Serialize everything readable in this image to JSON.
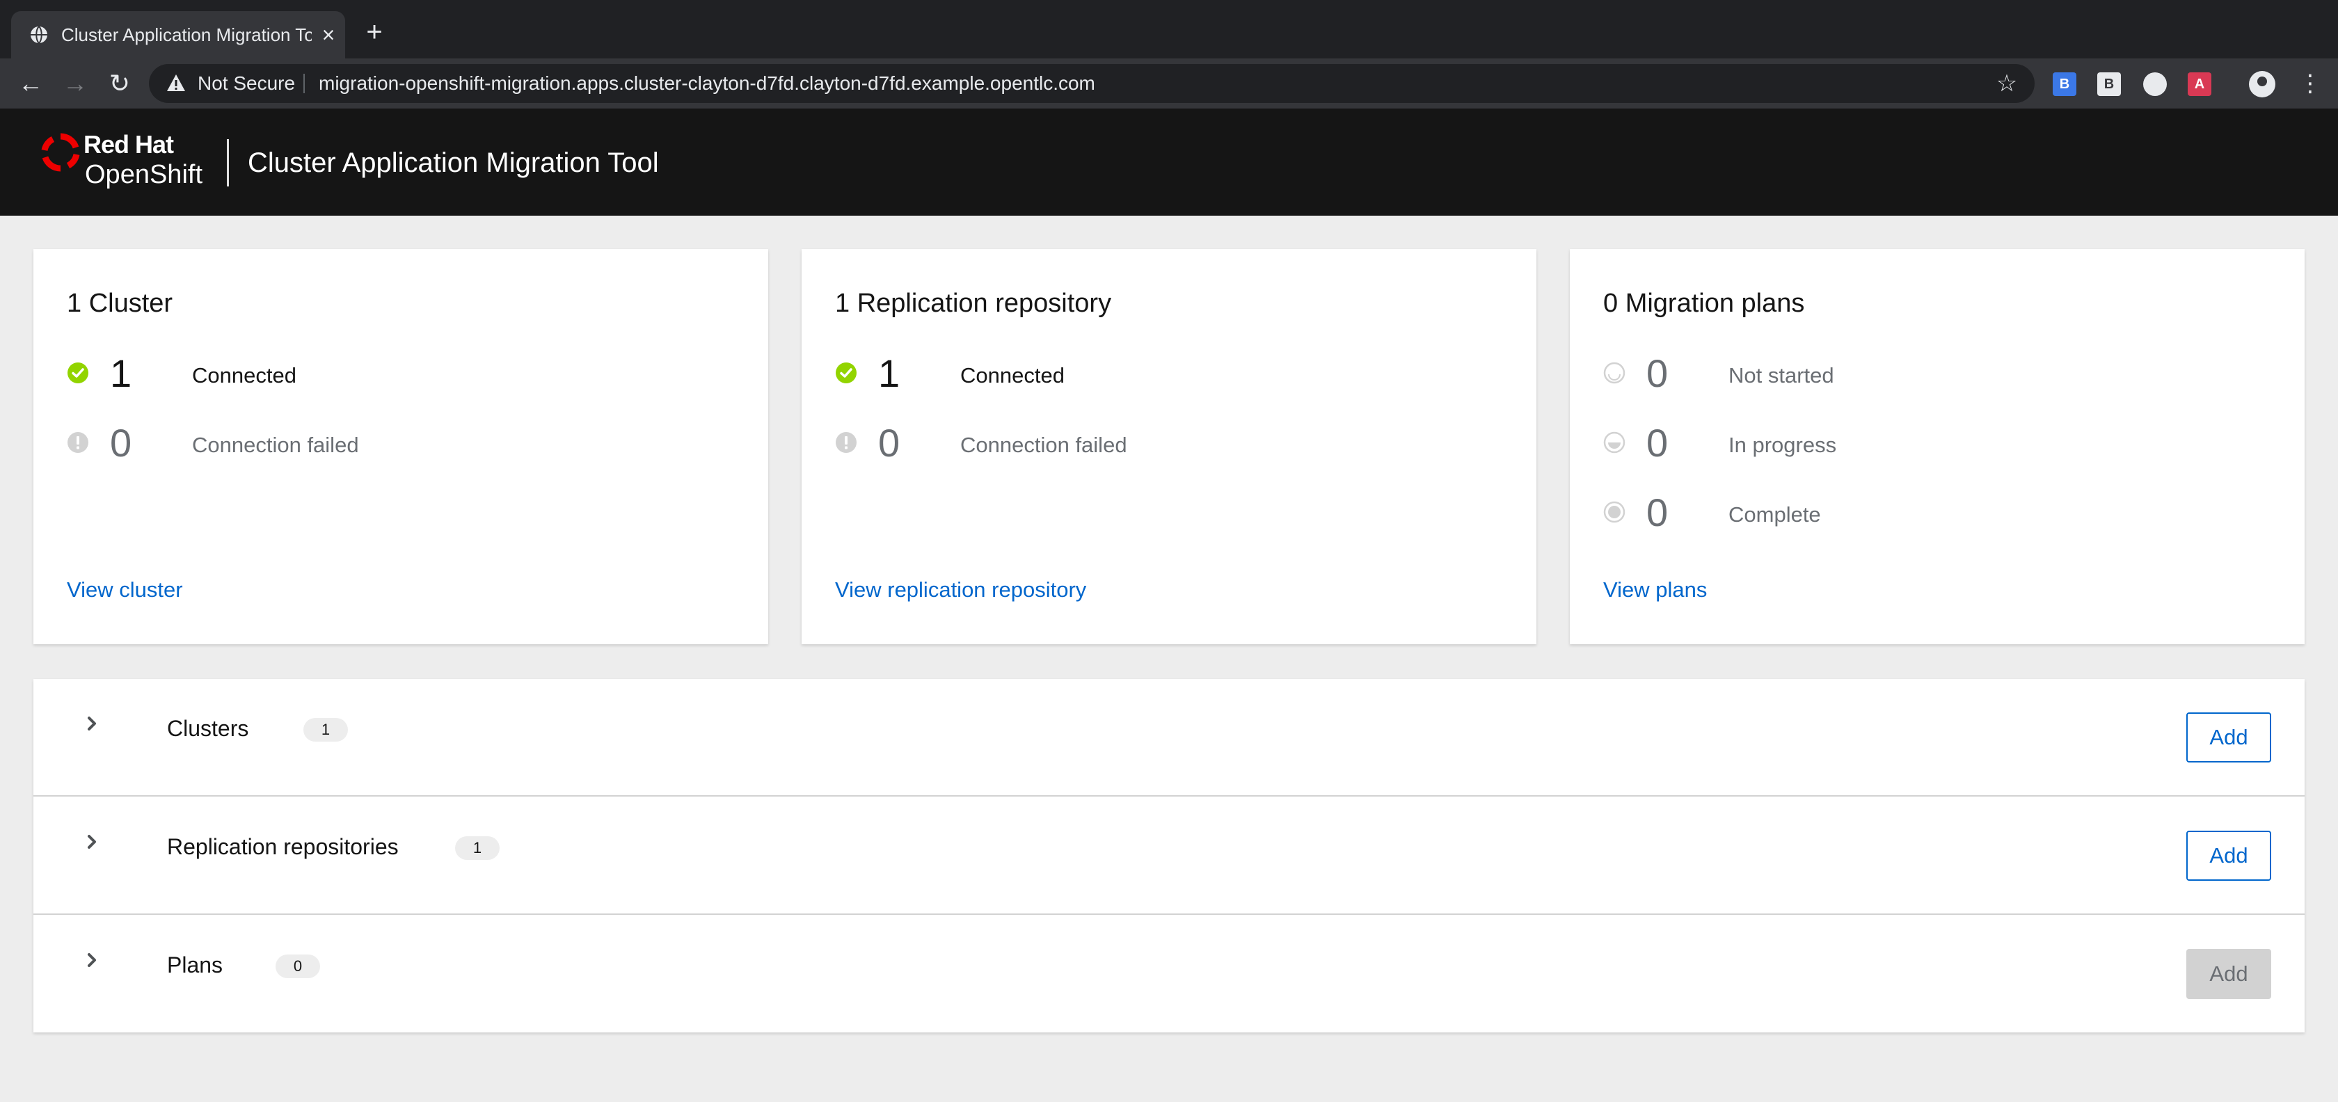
{
  "browser": {
    "tab_title": "Cluster Application Migration Tool",
    "security_label": "Not Secure",
    "url": "migration-openshift-migration.apps.cluster-clayton-d7fd.clayton-d7fd.example.opentlc.com",
    "extensions": [
      "B",
      "B",
      "",
      "A"
    ]
  },
  "header": {
    "brand_line1": "Red Hat",
    "brand_line2": "OpenShift",
    "app_title": "Cluster Application Migration Tool",
    "brand_color": "#ee0000"
  },
  "cards": {
    "clusters": {
      "title": "1 Cluster",
      "stats": [
        {
          "count": "1",
          "label": "Connected",
          "status": "success"
        },
        {
          "count": "0",
          "label": "Connection failed",
          "status": "error-muted"
        }
      ],
      "link": "View cluster"
    },
    "repositories": {
      "title": "1 Replication repository",
      "stats": [
        {
          "count": "1",
          "label": "Connected",
          "status": "success"
        },
        {
          "count": "0",
          "label": "Connection failed",
          "status": "error-muted"
        }
      ],
      "link": "View replication repository"
    },
    "plans": {
      "title": "0 Migration plans",
      "stats": [
        {
          "count": "0",
          "label": "Not started",
          "status": "not-started"
        },
        {
          "count": "0",
          "label": "In progress",
          "status": "in-progress"
        },
        {
          "count": "0",
          "label": "Complete",
          "status": "complete"
        }
      ],
      "link": "View plans"
    }
  },
  "sections": [
    {
      "title": "Clusters",
      "count": "1",
      "add_label": "Add",
      "add_enabled": true
    },
    {
      "title": "Replication repositories",
      "count": "1",
      "add_label": "Add",
      "add_enabled": true
    },
    {
      "title": "Plans",
      "count": "0",
      "add_label": "Add",
      "add_enabled": false
    }
  ],
  "colors": {
    "success": "#92d400",
    "link": "#0066cc",
    "muted": "#6a6e73"
  }
}
